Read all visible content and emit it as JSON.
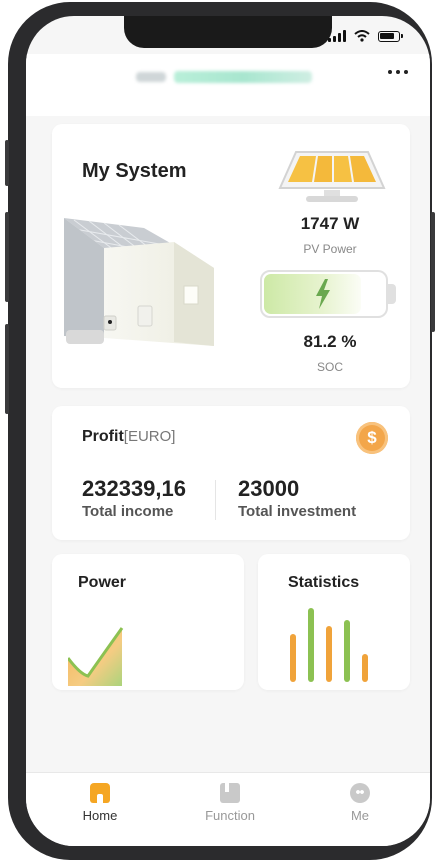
{
  "header": {
    "site_name_blurred": "SE AZ-SOLAR-POWER"
  },
  "system": {
    "title": "My System",
    "pv_power_value": "1747 W",
    "pv_power_label": "PV Power",
    "soc_value": "81.2 %",
    "soc_label": "SOC",
    "soc_level_percent": 81.2
  },
  "profit": {
    "title": "Profit",
    "unit": "[EURO]",
    "currency_icon": "dollar-coin-icon",
    "total_income_value": "232339,16",
    "total_income_label": "Total income",
    "total_investment_value": "23000",
    "total_investment_label": "Total investment"
  },
  "cards": {
    "power_title": "Power",
    "statistics_title": "Statistics"
  },
  "tabbar": {
    "items": [
      {
        "label": "Home",
        "icon": "home-icon",
        "active": true
      },
      {
        "label": "Function",
        "icon": "function-icon",
        "active": false
      },
      {
        "label": "Me",
        "icon": "me-icon",
        "active": false
      }
    ]
  },
  "colors": {
    "accent": "#f5a623",
    "green": "#8cc152",
    "solar_yellow": "#f6c143"
  }
}
